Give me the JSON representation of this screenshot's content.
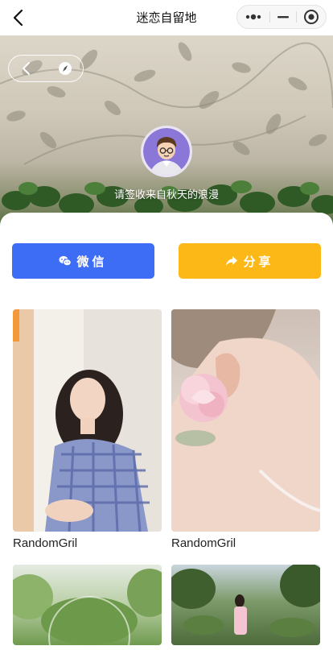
{
  "navbar": {
    "title": "迷恋自留地"
  },
  "hero": {
    "caption": "请签收来自秋天的浪漫"
  },
  "actions": {
    "wechat_label": "微信",
    "share_label": "分享"
  },
  "gallery": {
    "items": [
      {
        "label": "RandomGril"
      },
      {
        "label": "RandomGril"
      },
      {
        "label": ""
      },
      {
        "label": ""
      }
    ]
  },
  "colors": {
    "wechat_button": "#3d6cf5",
    "share_button": "#fcb817"
  }
}
